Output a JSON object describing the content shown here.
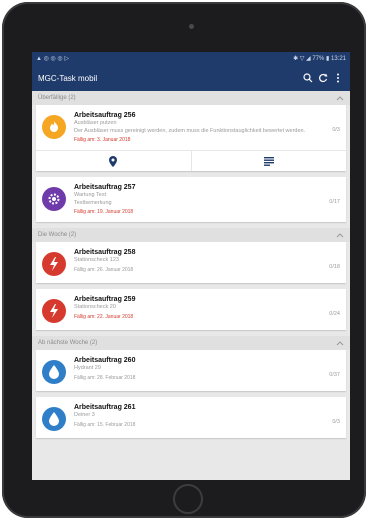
{
  "status": {
    "left": "▲ ◎ ◎ ◎ ▷",
    "right": "✱ ▽ ◢ 77% ▮ 13:21"
  },
  "app": {
    "title": "MGC-Task mobil"
  },
  "sections": {
    "overdue": {
      "label": "Überfällige (2)"
    },
    "week": {
      "label": "Die Woche (2)"
    },
    "nextweek": {
      "label": "Ab nächste Woche (2)"
    }
  },
  "tasks": [
    {
      "title": "Arbeitsauftrag 256",
      "subtitle": "Ausbläser putzen",
      "desc": "Der Ausbläser muss gereinigt werden, zudem muss die Funktionstauglichkeit bewertet werden.",
      "due": "Fällig am: 3. Januar 2018",
      "count": "0/3",
      "color": "#f5a623",
      "icon": "fire-icon"
    },
    {
      "title": "Arbeitsauftrag 257",
      "subtitle": "Wartung Test",
      "desc": "Textbemerkung",
      "due": "Fällig am: 19. Januar 2018",
      "count": "0/17",
      "color": "#6f3aa9",
      "icon": "gear-icon"
    },
    {
      "title": "Arbeitsauftrag 258",
      "subtitle": "Stationscheck 123",
      "desc": "",
      "due": "Fällig am: 26. Januar 2018",
      "count": "0/18",
      "color": "#d63a2f",
      "icon": "lightning-icon"
    },
    {
      "title": "Arbeitsauftrag 259",
      "subtitle": "Stationscheck 20",
      "desc": "",
      "due": "Fällig am: 22. Januar 2018",
      "count": "0/24",
      "color": "#d63a2f",
      "icon": "lightning-icon"
    },
    {
      "title": "Arbeitsauftrag 260",
      "subtitle": "Hydrant 29",
      "desc": "",
      "due": "Fällig am: 28. Februar 2018",
      "count": "0/37",
      "color": "#2f7fc8",
      "icon": "water-drop-icon"
    },
    {
      "title": "Arbeitsauftrag 261",
      "subtitle": "Deiner 3",
      "desc": "",
      "due": "Fällig am: 15. Februar 2018",
      "count": "0/3",
      "color": "#2f7fc8",
      "icon": "water-drop-icon"
    }
  ]
}
